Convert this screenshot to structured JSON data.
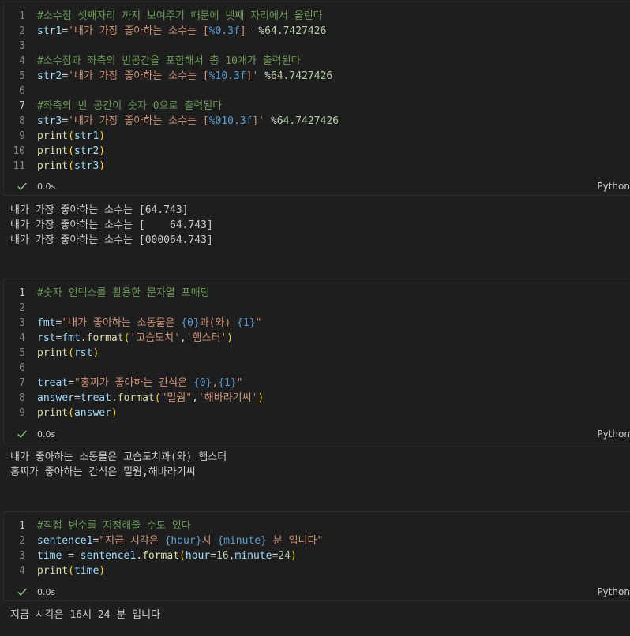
{
  "cells": [
    {
      "lines": [
        [
          {
            "c": "cm",
            "t": "#소수점 셋째자리 까지 보여주기 때문에 넷째 자리에서 올린다"
          }
        ],
        [
          {
            "c": "vr",
            "t": "str1"
          },
          {
            "c": "op",
            "t": "="
          },
          {
            "c": "st",
            "t": "'내가 가장 좋아하는 소수는 ["
          },
          {
            "c": "ph",
            "t": "%0.3f"
          },
          {
            "c": "st",
            "t": "]'"
          },
          {
            "c": "op",
            "t": " %"
          },
          {
            "c": "nu",
            "t": "64.7427426"
          }
        ],
        [],
        [
          {
            "c": "cm",
            "t": "#소수점과 좌측의 빈공간을 포함해서 총 10개가 출력된다"
          }
        ],
        [
          {
            "c": "vr",
            "t": "str2"
          },
          {
            "c": "op",
            "t": "="
          },
          {
            "c": "st",
            "t": "'내가 가장 좋아하는 소수는 ["
          },
          {
            "c": "ph",
            "t": "%10.3f"
          },
          {
            "c": "st",
            "t": "]'"
          },
          {
            "c": "op",
            "t": " %"
          },
          {
            "c": "nu",
            "t": "64.7427426"
          }
        ],
        [],
        [
          {
            "c": "cm",
            "t": "#좌측의 빈 공간이 숫자 0으로 출력된다"
          }
        ],
        [
          {
            "c": "vr",
            "t": "str3"
          },
          {
            "c": "op",
            "t": "="
          },
          {
            "c": "st",
            "t": "'내가 가장 좋아하는 소수는 ["
          },
          {
            "c": "ph",
            "t": "%010.3f"
          },
          {
            "c": "st",
            "t": "]'"
          },
          {
            "c": "op",
            "t": " %"
          },
          {
            "c": "nu",
            "t": "64.7427426"
          }
        ],
        [
          {
            "c": "fn",
            "t": "print"
          },
          {
            "c": "br",
            "t": "("
          },
          {
            "c": "vr",
            "t": "str1"
          },
          {
            "c": "br",
            "t": ")"
          }
        ],
        [
          {
            "c": "fn",
            "t": "print"
          },
          {
            "c": "br",
            "t": "("
          },
          {
            "c": "vr",
            "t": "str2"
          },
          {
            "c": "br",
            "t": ")"
          }
        ],
        [
          {
            "c": "fn",
            "t": "print"
          },
          {
            "c": "br",
            "t": "("
          },
          {
            "c": "vr",
            "t": "str3"
          },
          {
            "c": "br",
            "t": ")"
          }
        ]
      ],
      "active_line": 7,
      "time": "0.0s",
      "lang": "Python",
      "output": [
        "내가 가장 좋아하는 소수는 [64.743]",
        "내가 가장 좋아하는 소수는 [    64.743]",
        "내가 가장 좋아하는 소수는 [000064.743]"
      ]
    },
    {
      "lines": [
        [
          {
            "c": "cm",
            "t": "#숫자 인덱스를 활용한 문자열 포매팅"
          }
        ],
        [],
        [
          {
            "c": "vr",
            "t": "fmt"
          },
          {
            "c": "op",
            "t": "="
          },
          {
            "c": "st",
            "t": "\"내가 좋아하는 소동물은 "
          },
          {
            "c": "ph",
            "t": "{0}"
          },
          {
            "c": "st",
            "t": "과(와) "
          },
          {
            "c": "ph",
            "t": "{1}"
          },
          {
            "c": "st",
            "t": "\""
          }
        ],
        [
          {
            "c": "vr",
            "t": "rst"
          },
          {
            "c": "op",
            "t": "="
          },
          {
            "c": "vr",
            "t": "fmt"
          },
          {
            "c": "op",
            "t": "."
          },
          {
            "c": "fn",
            "t": "format"
          },
          {
            "c": "br",
            "t": "("
          },
          {
            "c": "st",
            "t": "'고슴도치'"
          },
          {
            "c": "op",
            "t": ","
          },
          {
            "c": "st",
            "t": "'햄스터'"
          },
          {
            "c": "br",
            "t": ")"
          }
        ],
        [
          {
            "c": "fn",
            "t": "print"
          },
          {
            "c": "br",
            "t": "("
          },
          {
            "c": "vr",
            "t": "rst"
          },
          {
            "c": "br",
            "t": ")"
          }
        ],
        [],
        [
          {
            "c": "vr",
            "t": "treat"
          },
          {
            "c": "op",
            "t": "="
          },
          {
            "c": "st",
            "t": "\"홍찌가 좋아하는 간식은 "
          },
          {
            "c": "ph",
            "t": "{0}"
          },
          {
            "c": "st",
            "t": ","
          },
          {
            "c": "ph",
            "t": "{1}"
          },
          {
            "c": "st",
            "t": "\""
          }
        ],
        [
          {
            "c": "vr",
            "t": "answer"
          },
          {
            "c": "op",
            "t": "="
          },
          {
            "c": "vr",
            "t": "treat"
          },
          {
            "c": "op",
            "t": "."
          },
          {
            "c": "fn",
            "t": "format"
          },
          {
            "c": "br",
            "t": "("
          },
          {
            "c": "st",
            "t": "\"밀웜\""
          },
          {
            "c": "op",
            "t": ","
          },
          {
            "c": "st",
            "t": "'해바라기씨'"
          },
          {
            "c": "br",
            "t": ")"
          }
        ],
        [
          {
            "c": "fn",
            "t": "print"
          },
          {
            "c": "br",
            "t": "("
          },
          {
            "c": "vr",
            "t": "answer"
          },
          {
            "c": "br",
            "t": ")"
          }
        ]
      ],
      "active_line": 1,
      "time": "0.0s",
      "lang": "Python",
      "output": [
        "내가 좋아하는 소동물은 고슴도치과(와) 햄스터",
        "홍찌가 좋아하는 간식은 밀웜,해바라기씨"
      ]
    },
    {
      "lines": [
        [
          {
            "c": "cm",
            "t": "#직접 변수를 지정해줄 수도 있다"
          }
        ],
        [
          {
            "c": "vr",
            "t": "sentence1"
          },
          {
            "c": "op",
            "t": "="
          },
          {
            "c": "st",
            "t": "\"지금 시각은 "
          },
          {
            "c": "ph",
            "t": "{hour}"
          },
          {
            "c": "st",
            "t": "시 "
          },
          {
            "c": "ph",
            "t": "{minute}"
          },
          {
            "c": "st",
            "t": " 분 입니다\""
          }
        ],
        [
          {
            "c": "vr",
            "t": "time"
          },
          {
            "c": "op",
            "t": " = "
          },
          {
            "c": "vr",
            "t": "sentence1"
          },
          {
            "c": "op",
            "t": "."
          },
          {
            "c": "fn",
            "t": "format"
          },
          {
            "c": "br",
            "t": "("
          },
          {
            "c": "vr",
            "t": "hour"
          },
          {
            "c": "op",
            "t": "="
          },
          {
            "c": "nu",
            "t": "16"
          },
          {
            "c": "op",
            "t": ","
          },
          {
            "c": "vr",
            "t": "minute"
          },
          {
            "c": "op",
            "t": "="
          },
          {
            "c": "nu",
            "t": "24"
          },
          {
            "c": "br",
            "t": ")"
          }
        ],
        [
          {
            "c": "fn",
            "t": "print"
          },
          {
            "c": "br",
            "t": "("
          },
          {
            "c": "vr",
            "t": "time"
          },
          {
            "c": "br",
            "t": ")"
          }
        ]
      ],
      "active_line": 1,
      "time": "0.0s",
      "lang": "Python",
      "output": [
        "지금 시각은 16시 24 분 입니다"
      ]
    }
  ]
}
